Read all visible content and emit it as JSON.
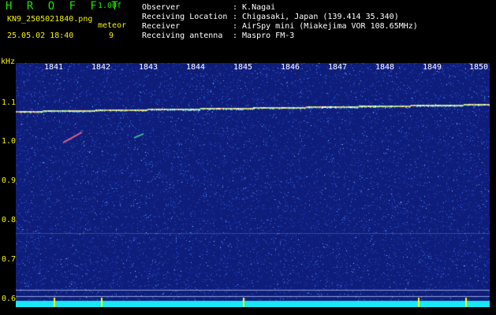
{
  "header": {
    "brand": "H R O F F T",
    "version": "1.00f",
    "filename": "KN9_2505021840.png",
    "timestamp": "25.05.02 18:40",
    "meteor_label": "meteor",
    "meteor_count": "9"
  },
  "info": [
    {
      "label": "Observer",
      "value": ": K.Nagai"
    },
    {
      "label": "Receiving Location",
      "value": ": Chigasaki, Japan (139.414 35.340)"
    },
    {
      "label": "Receiver",
      "value": ": AirSpy mini (Miakejima VOR 108.65MHz)"
    },
    {
      "label": "Receiving antenna",
      "value": ": Maspro FM-3"
    }
  ],
  "axis": {
    "y_unit": "kHz",
    "y_ticks": [
      "1.1",
      "1.0",
      "0.9",
      "0.8",
      "0.7",
      "0.6"
    ],
    "x_ticks": [
      "1841",
      "1842",
      "1843",
      "1844",
      "1845",
      "1846",
      "1847",
      "1848",
      "1849",
      "1850"
    ]
  },
  "colors": {
    "background": "#000000",
    "spectrogram_bg": "#0f1d7a",
    "carrier": "#e6e68a",
    "label_green": "#22e000",
    "label_yellow": "#f2f200",
    "bottom_bar": "#19e8f5"
  }
}
